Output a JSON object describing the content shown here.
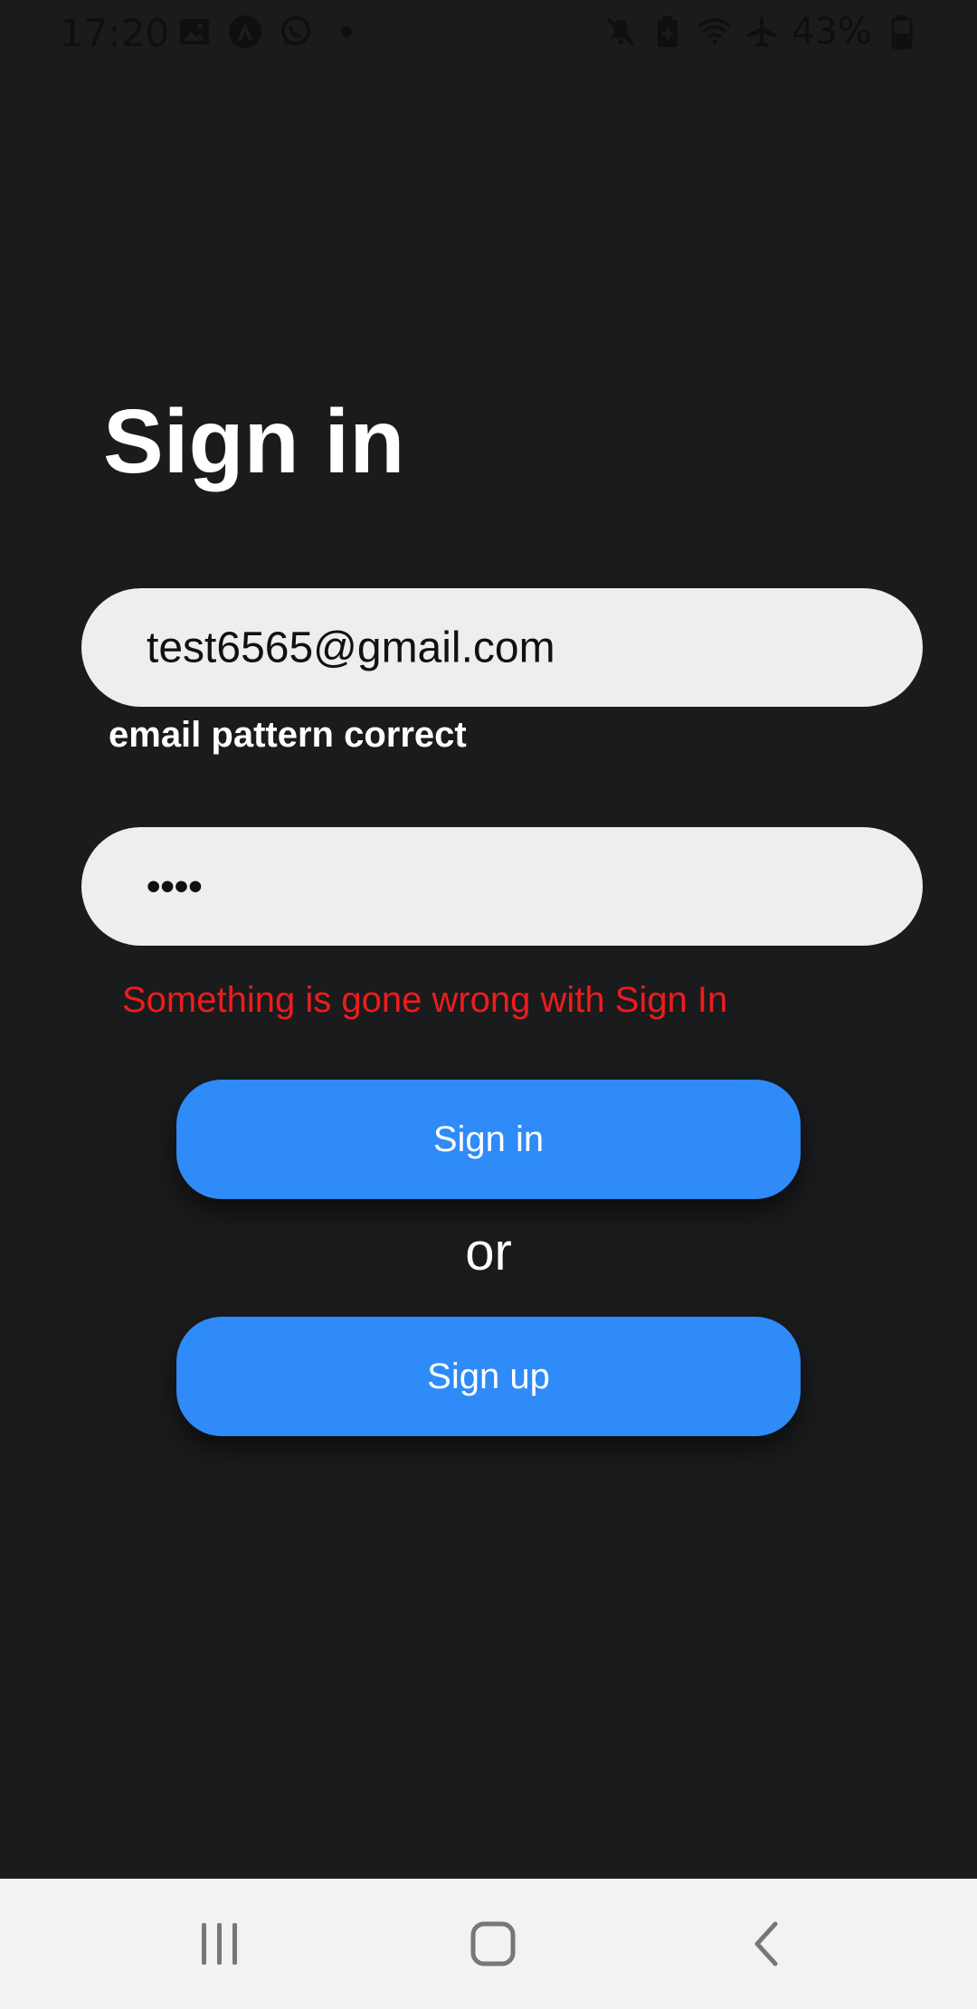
{
  "status_bar": {
    "time": "17:20",
    "battery": "43%",
    "icons_left": [
      "image-icon",
      "app-icon",
      "whatsapp-icon",
      "dot-icon"
    ],
    "icons_right": [
      "mute-icon",
      "battery-saver-icon",
      "wifi-icon",
      "airplane-icon",
      "battery-icon"
    ]
  },
  "page": {
    "title": "Sign in"
  },
  "form": {
    "email_value": "test6565@gmail.com",
    "email_hint": "email pattern correct",
    "password_masked": "••••",
    "error_message": "Something is gone wrong with Sign In"
  },
  "actions": {
    "sign_in_label": "Sign in",
    "or_label": "or",
    "sign_up_label": "Sign up"
  },
  "nav_bar": {
    "items": [
      "recents-icon",
      "home-icon",
      "back-icon"
    ]
  },
  "colors": {
    "background": "#1a1b1d",
    "input_background": "#efedee",
    "button": "#2e8bf7",
    "error": "#ee1c1c",
    "nav_background": "#f2f2f2"
  }
}
